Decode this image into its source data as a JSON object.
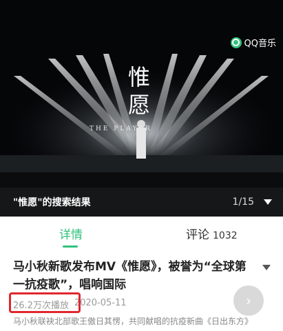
{
  "video": {
    "mv_title": "惟\n愿",
    "mv_subtitle": "THE PLAYER",
    "badge_label": "QQ音乐",
    "badge_icon": "qq-music-icon"
  },
  "result_bar": {
    "title": "\"惟愿\"的搜索结果",
    "page": "1/15",
    "toggle_icon": "triangle-down-icon"
  },
  "tabs": {
    "detail": "详情",
    "comments": "评论",
    "comments_count": "1032"
  },
  "detail": {
    "headline": "马小秋新歌发布MV《惟愿》，被誉为“全球第一抗疫歌”，唱响国际",
    "plays": "26.2万次播放",
    "date": "2020-05-11",
    "description": "马小秋联袂北部歌王傲日其愣，共同献唱的抗疫新曲《日出东方》"
  },
  "colors": {
    "accent": "#31c27c",
    "highlight_box": "#e0262e",
    "bar_bg": "#161718"
  }
}
